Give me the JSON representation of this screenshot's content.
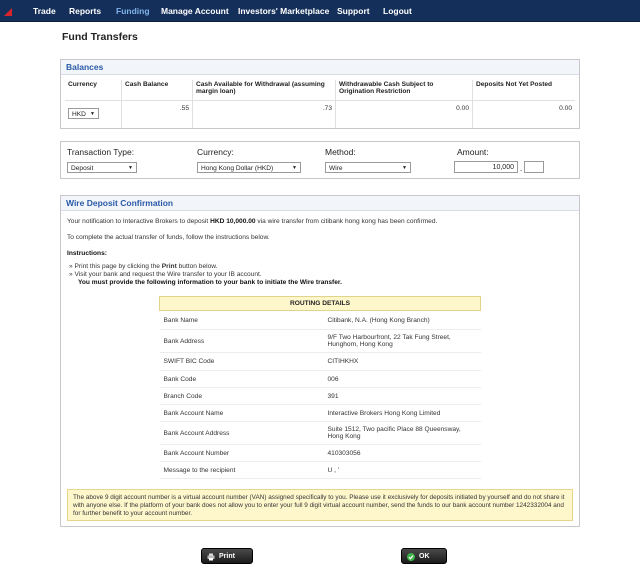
{
  "nav": {
    "items": [
      {
        "label": "Trade"
      },
      {
        "label": "Reports"
      },
      {
        "label": "Funding",
        "active": true
      },
      {
        "label": "Manage Account"
      },
      {
        "label": "Investors' Marketplace"
      },
      {
        "label": "Support"
      },
      {
        "label": "Logout"
      }
    ]
  },
  "page": {
    "title": "Fund Transfers"
  },
  "balances": {
    "heading": "Balances",
    "headers": [
      "Currency",
      "Cash Balance",
      "Cash Available for Withdrawal (assuming margin loan)",
      "Withdrawable Cash Subject to Origination Restriction",
      "Deposits Not Yet Posted"
    ],
    "currency": "HKD",
    "values": [
      ".55",
      ".73",
      "0.00",
      "0.00"
    ]
  },
  "transaction": {
    "type_label": "Transaction Type:",
    "type_value": "Deposit",
    "currency_label": "Currency:",
    "currency_value": "Hong Kong Dollar (HKD)",
    "method_label": "Method:",
    "method_value": "Wire",
    "amount_label": "Amount:",
    "amount_value": "10,000",
    "amount_sep": ".",
    "amount_decimal": ""
  },
  "confirmation": {
    "heading": "Wire Deposit Confirmation",
    "line1_pre": "Your notification to Interactive Brokers to deposit ",
    "line1_amount": "HKD 10,000.00",
    "line1_post": " via wire transfer from citibank hong kong has been confirmed.",
    "line2": "To complete the actual transfer of funds, follow the instructions below.",
    "instructions_label": "Instructions:",
    "step1_pre": "Print this page by clicking the ",
    "step1_bold": "Print",
    "step1_post": " button below.",
    "step2": "Visit your bank and request the Wire transfer to your IB account.",
    "step2_bold": "You must provide the following information to your bank to initiate the Wire transfer.",
    "bullet": "»"
  },
  "routing": {
    "title": "ROUTING DETAILS",
    "rows": [
      {
        "key": "Bank Name",
        "value": "Citibank, N.A. (Hong Kong Branch)"
      },
      {
        "key": "Bank Address",
        "value": "9/F Two Harbourfront, 22 Tak Fung Street, Hunghom, Hong Kong"
      },
      {
        "key": "SWIFT BIC Code",
        "value": "CITIHKHX"
      },
      {
        "key": "Bank Code",
        "value": "006"
      },
      {
        "key": "Branch Code",
        "value": "391"
      },
      {
        "key": "Bank Account Name",
        "value": "Interactive Brokers Hong Kong Limited"
      },
      {
        "key": "Bank Account Address",
        "value": "Suite 1512, Two pacific Place 88 Queensway, Hong Kong"
      },
      {
        "key": "Bank Account Number",
        "value": "410303056"
      },
      {
        "key": "Message to the recipient",
        "value": "U              ,              '"
      }
    ]
  },
  "note": {
    "text": "The above 9 digit account number is a virtual account number (VAN) assigned specifically to you. Please use it exclusively for deposits initiated by yourself and do not share it with anyone else. If the platform of your bank does not allow you to enter your full 9 digit virtual account number, send the funds to our bank account number 1242332004 and for further benefit to your account number."
  },
  "buttons": {
    "print": "Print",
    "ok": "OK"
  },
  "colors": {
    "nav_bg": "#14305a",
    "accent": "#2a5aa8",
    "note_bg": "#fff7cc",
    "ok_icon": "#3fb24a"
  }
}
